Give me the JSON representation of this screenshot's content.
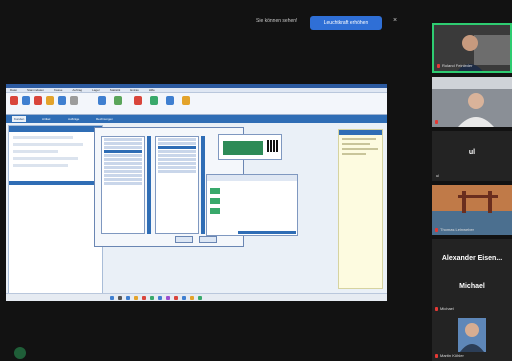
{
  "banner": {
    "message": "Sie können sehen!",
    "action_label": "Leuchtkraft erhöhen",
    "close_glyph": "×"
  },
  "shared_app": {
    "menu": [
      "Datei",
      "Stammdaten",
      "Kasse",
      "Auftrag",
      "Lager",
      "Statistik",
      "Extras",
      "Hilfe"
    ],
    "tabs": [
      "Kunden",
      "Artikel",
      "Aufträge",
      "Rechnungen"
    ],
    "dialog_left_title": "Auswahl",
    "dialog_right_title": "Auswahl",
    "accent_color": "#2f6db5",
    "alert_color": "#dd2222"
  },
  "participants": [
    {
      "name": "Roland Feinleder",
      "speaking": true
    },
    {
      "name": "",
      "speaking": false
    },
    {
      "name": "ul",
      "label": "ul",
      "speaking": false
    },
    {
      "name": "Thomas Leinweber",
      "speaking": false
    },
    {
      "name": "Alexander Eisenmann",
      "label": "Alexander  Eisen...",
      "speaking": false
    },
    {
      "name": "Michael",
      "label": "Michael",
      "speaking": false
    },
    {
      "name": "Martin Köhler",
      "speaking": false
    }
  ]
}
